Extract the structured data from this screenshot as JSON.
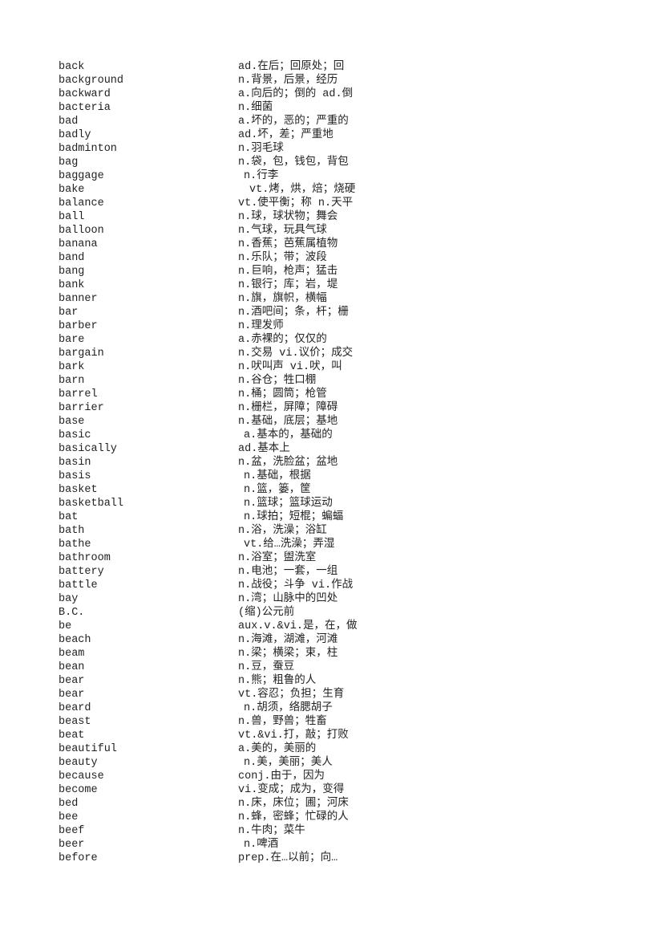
{
  "document": {
    "type": "vocabulary-list",
    "page_background": "#ffffff",
    "text_color": "#222222",
    "section_letter": "b",
    "columns": [
      "word",
      "definition"
    ]
  },
  "entries": [
    {
      "word": "back",
      "definition": "ad.在后；回原处；回",
      "indent": 0
    },
    {
      "word": "background",
      "definition": "n.背景，后景，经历",
      "indent": 0
    },
    {
      "word": "backward",
      "definition": "a.向后的；倒的 ad.倒",
      "indent": 0
    },
    {
      "word": "bacteria",
      "definition": "n.细菌",
      "indent": 0
    },
    {
      "word": "bad",
      "definition": "a.坏的，恶的；严重的",
      "indent": 0
    },
    {
      "word": "badly",
      "definition": "ad.坏，差；严重地",
      "indent": 0
    },
    {
      "word": "badminton",
      "definition": "n.羽毛球",
      "indent": 0
    },
    {
      "word": "bag",
      "definition": "n.袋，包，钱包，背包",
      "indent": 0
    },
    {
      "word": "baggage",
      "definition": "n.行李",
      "indent": 1
    },
    {
      "word": "bake",
      "definition": "vt.烤，烘，焙；烧硬",
      "indent": 2
    },
    {
      "word": "balance",
      "definition": "vt.使平衡；称 n.天平",
      "indent": 0
    },
    {
      "word": "ball",
      "definition": "n.球，球状物；舞会",
      "indent": 0
    },
    {
      "word": "balloon",
      "definition": "n.气球，玩具气球",
      "indent": 0
    },
    {
      "word": "banana",
      "definition": "n.香蕉；芭蕉属植物",
      "indent": 0
    },
    {
      "word": "band",
      "definition": "n.乐队；带；波段",
      "indent": 0
    },
    {
      "word": "bang",
      "definition": "n.巨响，枪声；猛击",
      "indent": 0
    },
    {
      "word": "bank",
      "definition": "n.银行；库；岩，堤",
      "indent": 0
    },
    {
      "word": "banner",
      "definition": "n.旗，旗帜，横幅",
      "indent": 0
    },
    {
      "word": "bar",
      "definition": "n.酒吧间；条，杆；栅",
      "indent": 0
    },
    {
      "word": "barber",
      "definition": "n.理发师",
      "indent": 0
    },
    {
      "word": "bare",
      "definition": "a.赤裸的；仅仅的",
      "indent": 0
    },
    {
      "word": "bargain",
      "definition": "n.交易 vi.议价；成交",
      "indent": 0
    },
    {
      "word": "bark",
      "definition": "n.吠叫声 vi.吠，叫",
      "indent": 0
    },
    {
      "word": "barn",
      "definition": "n.谷仓；牲口棚",
      "indent": 0
    },
    {
      "word": "barrel",
      "definition": "n.桶；圆筒；枪管",
      "indent": 0
    },
    {
      "word": "barrier",
      "definition": "n.栅栏，屏障；障碍",
      "indent": 0
    },
    {
      "word": "base",
      "definition": "n.基础，底层；基地",
      "indent": 0
    },
    {
      "word": "basic",
      "definition": "a.基本的，基础的",
      "indent": 1
    },
    {
      "word": "basically",
      "definition": "ad.基本上",
      "indent": 0
    },
    {
      "word": "basin",
      "definition": "n.盆，洗脸盆；盆地",
      "indent": 0
    },
    {
      "word": "basis",
      "definition": "n.基础，根据",
      "indent": 1
    },
    {
      "word": "basket",
      "definition": "n.篮，篓，筐",
      "indent": 1
    },
    {
      "word": "basketball",
      "definition": "n.篮球；篮球运动",
      "indent": 1
    },
    {
      "word": "bat",
      "definition": "n.球拍；短棍；蝙蝠",
      "indent": 1
    },
    {
      "word": "bath",
      "definition": "n.浴，洗澡；浴缸",
      "indent": 0
    },
    {
      "word": "bathe",
      "definition": "vt.给…洗澡；弄湿",
      "indent": 1
    },
    {
      "word": "bathroom",
      "definition": "n.浴室；盥洗室",
      "indent": 0
    },
    {
      "word": "battery",
      "definition": "n.电池；一套，一组",
      "indent": 0
    },
    {
      "word": "battle",
      "definition": "n.战役；斗争 vi.作战",
      "indent": 0
    },
    {
      "word": "bay",
      "definition": "n.湾；山脉中的凹处",
      "indent": 0
    },
    {
      "word": "B.C.",
      "definition": "(缩)公元前",
      "indent": 0
    },
    {
      "word": "be",
      "definition": "aux.v.&vi.是，在，做",
      "indent": 0
    },
    {
      "word": "beach",
      "definition": "n.海滩，湖滩，河滩",
      "indent": 0
    },
    {
      "word": "beam",
      "definition": "n.梁；横梁；束，柱",
      "indent": 0
    },
    {
      "word": "bean",
      "definition": "n.豆，蚕豆",
      "indent": 0
    },
    {
      "word": "bear",
      "definition": "n.熊；粗鲁的人",
      "indent": 0
    },
    {
      "word": "bear",
      "definition": "vt.容忍；负担；生育",
      "indent": 0
    },
    {
      "word": "beard",
      "definition": "n.胡须，络腮胡子",
      "indent": 1
    },
    {
      "word": "beast",
      "definition": "n.兽，野兽；牲畜",
      "indent": 0
    },
    {
      "word": "beat",
      "definition": "vt.&vi.打，敲；打败",
      "indent": 0
    },
    {
      "word": "beautiful",
      "definition": "a.美的，美丽的",
      "indent": 0
    },
    {
      "word": "beauty",
      "definition": "n.美，美丽；美人",
      "indent": 1
    },
    {
      "word": "because",
      "definition": "conj.由于，因为",
      "indent": 0
    },
    {
      "word": "become",
      "definition": "vi.变成；成为，变得",
      "indent": 0
    },
    {
      "word": "bed",
      "definition": "n.床，床位；圃；河床",
      "indent": 0
    },
    {
      "word": "bee",
      "definition": "n.蜂，密蜂；忙碌的人",
      "indent": 0
    },
    {
      "word": "beef",
      "definition": "n.牛肉；菜牛",
      "indent": 0
    },
    {
      "word": "beer",
      "definition": "n.啤酒",
      "indent": 1
    },
    {
      "word": "before",
      "definition": "prep.在…以前；向…",
      "indent": 0
    }
  ]
}
